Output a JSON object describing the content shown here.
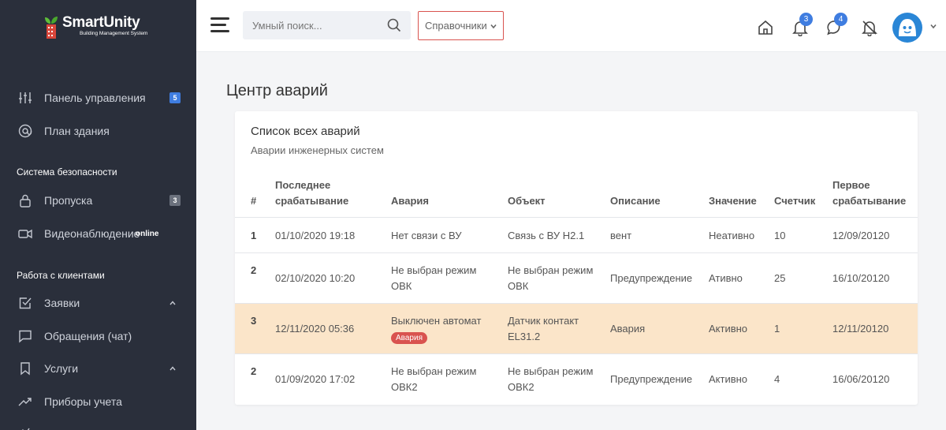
{
  "brand": {
    "title": "SmartUnity",
    "subtitle": "Building Management System"
  },
  "sidebar": {
    "items": [
      {
        "label": "Панель управления",
        "badge": "5"
      },
      {
        "label": "План здания"
      },
      {
        "label": "Пропуска",
        "badge": "3"
      },
      {
        "label": "Видеонаблюдение",
        "extra": "online"
      },
      {
        "label": "Заявки"
      },
      {
        "label": "Обращения (чат)"
      },
      {
        "label": "Услуги"
      },
      {
        "label": "Приборы учета"
      }
    ],
    "sections": [
      "Система безопасности",
      "Работа с клиентами"
    ]
  },
  "topbar": {
    "search_placeholder": "Умный поиск...",
    "references_label": "Справочники",
    "notifications_count": "3",
    "messages_count": "4"
  },
  "page": {
    "title": "Центр аварий"
  },
  "card": {
    "title": "Список всех аварий",
    "subtitle": "Аварии инженерных систем"
  },
  "table": {
    "headers": {
      "num": "#",
      "last": "Последнее срабатывание",
      "alarm": "Авария",
      "object": "Объект",
      "desc": "Описание",
      "value": "Значение",
      "counter": "Счетчик",
      "first": "Первое срабатывание"
    },
    "rows": [
      {
        "num": "1",
        "last": "01/10/2020 19:18",
        "alarm": "Нет связи с ВУ",
        "object": "Связь с ВУ Н2.1",
        "desc": "вент",
        "value": "Неативно",
        "counter": "10",
        "first": "12/09/20120"
      },
      {
        "num": "2",
        "last": "02/10/2020 10:20",
        "alarm": "Не выбран режим ОВК",
        "object": "Не выбран режим ОВК",
        "desc": "Предупреждение",
        "value": "Ативно",
        "counter": "25",
        "first": "16/10/20120"
      },
      {
        "num": "3",
        "last": "12/11/2020 05:36",
        "alarm": "Выключен автомат",
        "tag": "Авария",
        "object": "Датчик контакт EL31.2",
        "desc": "Авария",
        "value": "Активно",
        "counter": "1",
        "first": "12/11/20120"
      },
      {
        "num": "2",
        "last": "01/09/2020 17:02",
        "alarm": "Не выбран режим ОВК2",
        "object": "Не выбран режим ОВК2",
        "desc": "Предупреждение",
        "value": "Активно",
        "counter": "4",
        "first": "16/06/20120"
      }
    ]
  },
  "colors": {
    "sidebar_bg": "#2a2f3b",
    "accent": "#3f7de0",
    "alert": "#d9534f",
    "highlight_row": "#fbe5c9"
  }
}
